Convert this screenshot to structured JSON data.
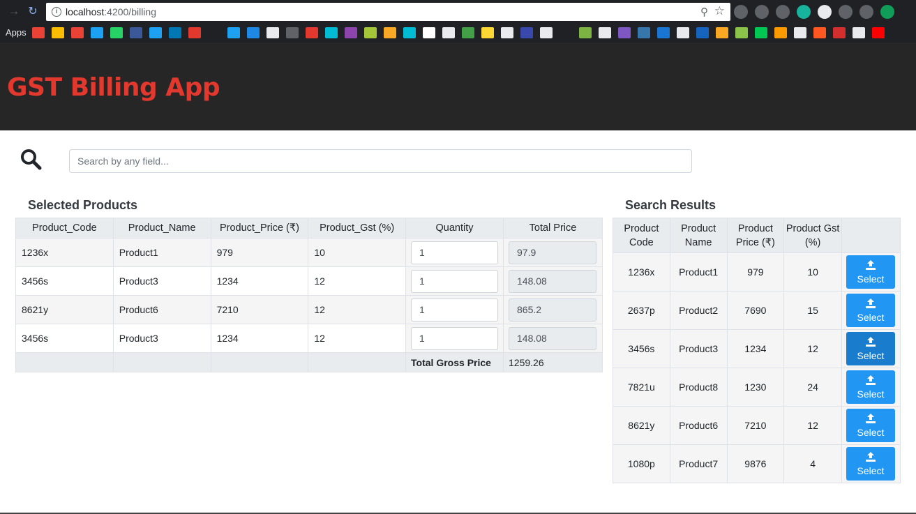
{
  "browser": {
    "url_host": "localhost",
    "url_path": ":4200/billing",
    "apps_label": "Apps",
    "ext_colors": [
      "#5f6368",
      "#5f6368",
      "#5f6368",
      "#17b39c",
      "#e8eaed",
      "#5f6368",
      "#5f6368",
      "#0f9d58"
    ],
    "bookmark_colors": [
      "#ea4335",
      "#fbbc04",
      "#ea4335",
      "#1da1f2",
      "#25d366",
      "#3b5998",
      "#1da1f2",
      "#0077b5",
      "#e2382e",
      "#202124",
      "#1da1f2",
      "#1e88e5",
      "#e8eaed",
      "#5f6368",
      "#e2382e",
      "#00bcd4",
      "#8e44ad",
      "#a4c639",
      "#f9a825",
      "#00bcd4",
      "#fff",
      "#e8eaed",
      "#43a047",
      "#fdd835",
      "#e8eaed",
      "#3949ab",
      "#e8eaed",
      "#202124",
      "#7cb342",
      "#e8eaed",
      "#7e57c2",
      "#3776ab",
      "#1976d2",
      "#e8eaed",
      "#1565c0",
      "#f9a825",
      "#8bc34a",
      "#00c853",
      "#ff9900",
      "#e8eaed",
      "#ff5722",
      "#d32f2f",
      "#e8eaed",
      "#ff0000"
    ]
  },
  "app": {
    "title": "GST Billing App",
    "search_placeholder": "Search by any field..."
  },
  "selected": {
    "title": "Selected Products",
    "headers": [
      "Product_Code",
      "Product_Name",
      "Product_Price (₹)",
      "Product_Gst (%)",
      "Quantity",
      "Total Price"
    ],
    "rows": [
      {
        "code": "1236x",
        "name": "Product1",
        "price": "979",
        "gst": "10",
        "qty": "1",
        "total": "97.9"
      },
      {
        "code": "3456s",
        "name": "Product3",
        "price": "1234",
        "gst": "12",
        "qty": "1",
        "total": "148.08"
      },
      {
        "code": "8621y",
        "name": "Product6",
        "price": "7210",
        "gst": "12",
        "qty": "1",
        "total": "865.2"
      },
      {
        "code": "3456s",
        "name": "Product3",
        "price": "1234",
        "gst": "12",
        "qty": "1",
        "total": "148.08"
      }
    ],
    "gross_label": "Total Gross Price",
    "gross_value": "1259.26"
  },
  "results": {
    "title": "Search Results",
    "headers": [
      "Product Code",
      "Product Name",
      "Product Price (₹)",
      "Product Gst (%)",
      ""
    ],
    "select_label": "Select",
    "rows": [
      {
        "code": "1236x",
        "name": "Product1",
        "price": "979",
        "gst": "10"
      },
      {
        "code": "2637p",
        "name": "Product2",
        "price": "7690",
        "gst": "15"
      },
      {
        "code": "3456s",
        "name": "Product3",
        "price": "1234",
        "gst": "12"
      },
      {
        "code": "7821u",
        "name": "Product8",
        "price": "1230",
        "gst": "24"
      },
      {
        "code": "8621y",
        "name": "Product6",
        "price": "7210",
        "gst": "12"
      },
      {
        "code": "1080p",
        "name": "Product7",
        "price": "9876",
        "gst": "4"
      }
    ]
  }
}
